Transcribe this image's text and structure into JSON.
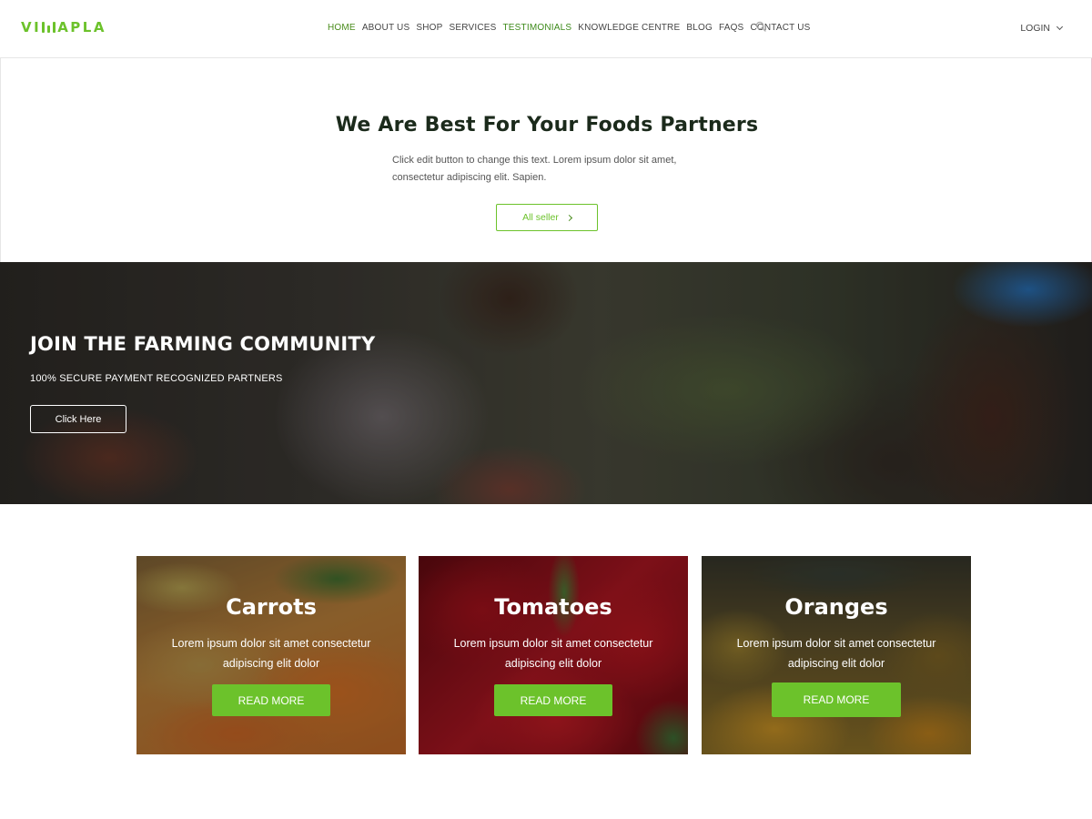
{
  "header": {
    "logo": {
      "prefix": "VI",
      "suffix": "APLA"
    },
    "nav": [
      {
        "label": "HOME"
      },
      {
        "label": "ABOUT US"
      },
      {
        "label": "SHOP"
      },
      {
        "label": "SERVICES"
      },
      {
        "label": "TESTIMONIALS"
      },
      {
        "label": "KNOWLEDGE CENTRE"
      },
      {
        "label": "BLOG"
      },
      {
        "label": "FAQS"
      },
      {
        "label": "CONTACT US"
      }
    ],
    "login_label": "LOGIN"
  },
  "intro": {
    "title": "We Are Best For Your Foods Partners",
    "text": "Click edit button to change this text. Lorem ipsum dolor sit amet, consectetur adipiscing elit. Sapien.",
    "button_label": "All seller"
  },
  "hero": {
    "title": "JOIN THE FARMING COMMUNITY",
    "subtitle": "100% SECURE PAYMENT RECOGNIZED PARTNERS",
    "button_label": "Click Here"
  },
  "cards": [
    {
      "title": "Carrots",
      "text": "Lorem ipsum dolor sit amet consectetur adipiscing elit dolor",
      "button_label": "READ MORE"
    },
    {
      "title": "Tomatoes",
      "text": "Lorem ipsum dolor sit amet consectetur adipiscing elit dolor",
      "button_label": "READ MORE"
    },
    {
      "title": "Oranges",
      "text": "Lorem ipsum dolor sit amet consectetur adipiscing elit dolor",
      "button_label": "READ MORE"
    }
  ],
  "colors": {
    "accent": "#6cc22b",
    "nav_active": "#4a8c1c",
    "heading": "#1b2a1b"
  }
}
